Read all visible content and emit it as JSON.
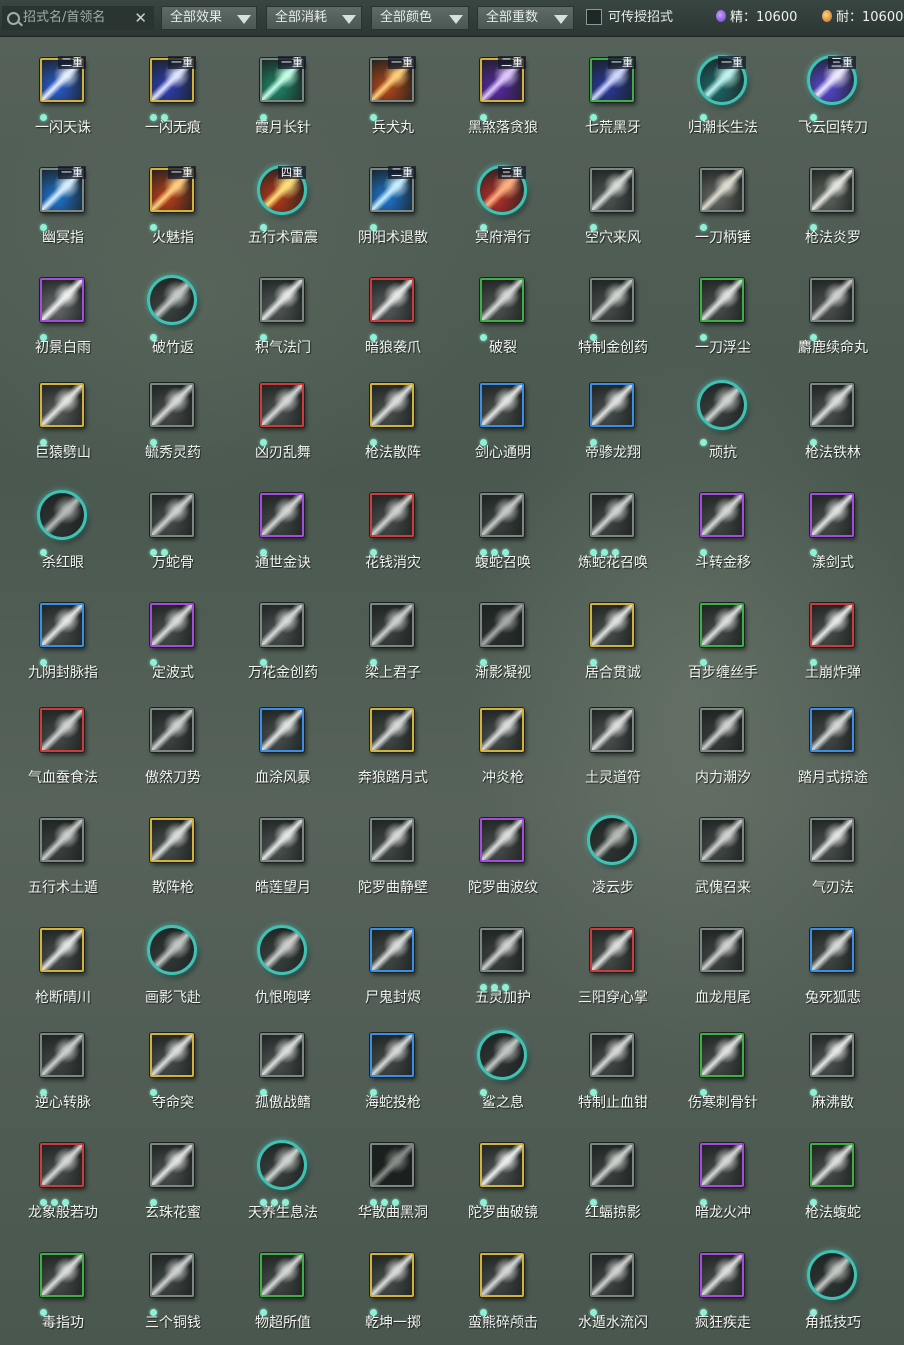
{
  "filters": {
    "search_placeholder": "招式名/首领名",
    "clear_glyph": "✕",
    "effect": "全部效果",
    "cost": "全部消耗",
    "color": "全部颜色",
    "tier": "全部重数",
    "passable_label": "可传授招式",
    "passable_checked": false
  },
  "resources": {
    "essence": "精：10600",
    "endurance": "耐：10600"
  },
  "border_colors": {
    "gold": "#d4b23a",
    "purple": "#a64ae0",
    "blue": "#3b8ee6",
    "red": "#cf3b3b",
    "green": "#3fae47",
    "gray": "#7c8682",
    "round": "#3fc2b4"
  },
  "skills": [
    {
      "name": "一闪天诛",
      "border": "gold",
      "tier": "二重",
      "dots": 1,
      "art": [
        "#2a5fd8",
        "#e6f0ff"
      ]
    },
    {
      "name": "一闪无痕",
      "border": "gold",
      "tier": "一重",
      "dots": 2,
      "art": [
        "#2f3fb8",
        "#dfe6ff"
      ]
    },
    {
      "name": "霞月长针",
      "border": "gray",
      "tier": "一重",
      "dots": 1,
      "art": [
        "#1f8a6a",
        "#c6ffe8"
      ]
    },
    {
      "name": "兵犬丸",
      "border": "gray",
      "tier": "一重",
      "dots": 1,
      "art": [
        "#b8491a",
        "#ffcf7a"
      ]
    },
    {
      "name": "黑煞落贪狼",
      "border": "gold",
      "tier": "二重",
      "dots": 1,
      "art": [
        "#5a2aa8",
        "#e0c8ff"
      ]
    },
    {
      "name": "七荒黑牙",
      "border": "green",
      "tier": "一重",
      "dots": 1,
      "art": [
        "#2a3aa0",
        "#d0d8ff"
      ]
    },
    {
      "name": "归潮长生法",
      "border": "round",
      "tier": "一重",
      "dots": 1,
      "art": [
        "#1d6a6a",
        "#bff5ee"
      ]
    },
    {
      "name": "飞云回转刀",
      "border": "round",
      "tier": "三重",
      "dots": 1,
      "art": [
        "#5a4ad8",
        "#eee8ff"
      ]
    },
    {
      "name": "幽冥指",
      "border": "gray",
      "tier": "一重",
      "dots": 1,
      "art": [
        "#1e78d8",
        "#d8f0ff"
      ]
    },
    {
      "name": "火魅指",
      "border": "gold",
      "tier": "一重",
      "dots": 1,
      "art": [
        "#c2401a",
        "#ffd080"
      ]
    },
    {
      "name": "五行术雷震",
      "border": "round",
      "tier": "四重",
      "dots": 1,
      "art": [
        "#b83a1a",
        "#ffe07a"
      ]
    },
    {
      "name": "阴阳术退散",
      "border": "gray",
      "tier": "二重",
      "dots": 1,
      "art": [
        "#1e7ad8",
        "#c8f0ff"
      ]
    },
    {
      "name": "冥府滑行",
      "border": "round",
      "tier": "三重",
      "dots": 1,
      "art": [
        "#b8302a",
        "#ffb080"
      ]
    },
    {
      "name": "空穴来风",
      "border": "gray",
      "tier": "",
      "dots": 1,
      "art": [
        "#505a58",
        "#d8dcd8"
      ]
    },
    {
      "name": "一刀柄锤",
      "border": "gray",
      "tier": "",
      "dots": 1,
      "art": [
        "#6a6c66",
        "#e0ded2"
      ]
    },
    {
      "name": "枪法炎罗",
      "border": "gray",
      "tier": "",
      "dots": 1,
      "art": [
        "#626860",
        "#e6e6e0"
      ]
    },
    {
      "name": "初景白雨",
      "border": "purple",
      "tier": "",
      "dots": 1,
      "art": [
        "#6a6e70",
        "#f0f0f0"
      ]
    },
    {
      "name": "破竹返",
      "border": "round",
      "tier": "",
      "dots": 1,
      "art": [
        "#3c4442",
        "#c8ccc8"
      ]
    },
    {
      "name": "积气法门",
      "border": "gray",
      "tier": "",
      "dots": 1,
      "art": [
        "#555c5a",
        "#e6e8e6"
      ]
    },
    {
      "name": "暗狼袭爪",
      "border": "red",
      "tier": "",
      "dots": 1,
      "art": [
        "#5a5e60",
        "#e8e8e8"
      ]
    },
    {
      "name": "破裂",
      "border": "green",
      "tier": "",
      "dots": 1,
      "art": [
        "#505654",
        "#d8dad8"
      ]
    },
    {
      "name": "特制金创药",
      "border": "gray",
      "tier": "",
      "dots": 1,
      "art": [
        "#4a504e",
        "#d0d4d0"
      ]
    },
    {
      "name": "一刀浮尘",
      "border": "green",
      "tier": "",
      "dots": 1,
      "art": [
        "#4c5250",
        "#e0e2e0"
      ]
    },
    {
      "name": "麝鹿续命丸",
      "border": "gray",
      "tier": "",
      "dots": 1,
      "art": [
        "#505452",
        "#d0d2d0"
      ]
    },
    {
      "name": "巨猿劈山",
      "border": "gold",
      "tier": "",
      "dots": 1,
      "art": [
        "#5a5e5c",
        "#e4e4e0"
      ]
    },
    {
      "name": "毓秀灵药",
      "border": "gray",
      "tier": "",
      "dots": 1,
      "art": [
        "#4a4e4c",
        "#d8dad8"
      ]
    },
    {
      "name": "凶刃乱舞",
      "border": "red",
      "tier": "",
      "dots": 1,
      "art": [
        "#4e5250",
        "#d6d8d6"
      ]
    },
    {
      "name": "枪法散阵",
      "border": "gold",
      "tier": "",
      "dots": 1,
      "art": [
        "#4c5250",
        "#dcdedc"
      ]
    },
    {
      "name": "剑心通明",
      "border": "blue",
      "tier": "",
      "dots": 1,
      "art": [
        "#4c5250",
        "#e2e4e2"
      ]
    },
    {
      "name": "帝骖龙翔",
      "border": "blue",
      "tier": "",
      "dots": 1,
      "art": [
        "#4a5050",
        "#e0e2e0"
      ]
    },
    {
      "name": "顽抗",
      "border": "round",
      "tier": "",
      "dots": 1,
      "art": [
        "#3a4240",
        "#d0d4d0"
      ]
    },
    {
      "name": "枪法铁林",
      "border": "gray",
      "tier": "",
      "dots": 1,
      "art": [
        "#4e5452",
        "#dcdedc"
      ]
    },
    {
      "name": "杀红眼",
      "border": "round",
      "tier": "",
      "dots": 1,
      "art": [
        "#2e3634",
        "#b8bcb8"
      ]
    },
    {
      "name": "万蛇骨",
      "border": "gray",
      "tier": "",
      "dots": 2,
      "art": [
        "#4a504e",
        "#cfd2cf"
      ]
    },
    {
      "name": "通世金诀",
      "border": "purple",
      "tier": "",
      "dots": 1,
      "art": [
        "#444a48",
        "#d4d6d4"
      ]
    },
    {
      "name": "花钱消灾",
      "border": "red",
      "tier": "",
      "dots": 1,
      "art": [
        "#4a4e4c",
        "#d0d2d0"
      ]
    },
    {
      "name": "蝮蛇召唤",
      "border": "gray",
      "tier": "",
      "dots": 3,
      "art": [
        "#3e4442",
        "#c8ccc8"
      ]
    },
    {
      "name": "炼蛇花召唤",
      "border": "gray",
      "tier": "",
      "dots": 3,
      "art": [
        "#424846",
        "#d2d4d2"
      ]
    },
    {
      "name": "斗转金移",
      "border": "purple",
      "tier": "",
      "dots": 1,
      "art": [
        "#464c4a",
        "#d6d8d6"
      ]
    },
    {
      "name": "漾剑式",
      "border": "purple",
      "tier": "",
      "dots": 1,
      "art": [
        "#4a504e",
        "#e0e2e0"
      ]
    },
    {
      "name": "九阴封脉指",
      "border": "blue",
      "tier": "",
      "dots": 1,
      "art": [
        "#4c5250",
        "#e4e6e4"
      ]
    },
    {
      "name": "定波式",
      "border": "purple",
      "tier": "",
      "dots": 1,
      "art": [
        "#4a504e",
        "#dadcda"
      ]
    },
    {
      "name": "万花金创药",
      "border": "gray",
      "tier": "",
      "dots": 1,
      "art": [
        "#4e5452",
        "#d8dad8"
      ]
    },
    {
      "name": "梁上君子",
      "border": "gray",
      "tier": "",
      "dots": 1,
      "art": [
        "#3e4442",
        "#cdd0cd"
      ]
    },
    {
      "name": "渐影凝视",
      "border": "gray",
      "tier": "",
      "dots": 1,
      "art": [
        "#2c3230",
        "#a8aca8"
      ]
    },
    {
      "name": "居合贯诚",
      "border": "gold",
      "tier": "",
      "dots": 1,
      "art": [
        "#4a504e",
        "#e0e2e0"
      ]
    },
    {
      "name": "百步缠丝手",
      "border": "green",
      "tier": "",
      "dots": 1,
      "art": [
        "#464c4a",
        "#dcdedc"
      ]
    },
    {
      "name": "土崩炸弹",
      "border": "red",
      "tier": "",
      "dots": 1,
      "art": [
        "#4a504e",
        "#e6e8e6"
      ]
    },
    {
      "name": "气血蚕食法",
      "border": "red",
      "tier": "",
      "dots": 0,
      "art": [
        "#464c4a",
        "#d2d4d2"
      ]
    },
    {
      "name": "傲然刀势",
      "border": "gray",
      "tier": "",
      "dots": 0,
      "art": [
        "#424846",
        "#d0d2d0"
      ]
    },
    {
      "name": "血涂风暴",
      "border": "blue",
      "tier": "",
      "dots": 0,
      "art": [
        "#4a5050",
        "#e2e4e2"
      ]
    },
    {
      "name": "奔狼踏月式",
      "border": "gold",
      "tier": "",
      "dots": 0,
      "art": [
        "#464c4a",
        "#d8dad8"
      ]
    },
    {
      "name": "冲炎枪",
      "border": "gold",
      "tier": "",
      "dots": 0,
      "art": [
        "#4a504e",
        "#dcdedc"
      ]
    },
    {
      "name": "土灵道符",
      "border": "gray",
      "tier": "",
      "dots": 0,
      "art": [
        "#505654",
        "#dcdedc"
      ]
    },
    {
      "name": "内力潮汐",
      "border": "gray",
      "tier": "",
      "dots": 0,
      "art": [
        "#3a403e",
        "#cfd2cf"
      ]
    },
    {
      "name": "踏月式掠途",
      "border": "blue",
      "tier": "",
      "dots": 0,
      "art": [
        "#464c4a",
        "#d6d8d6"
      ]
    },
    {
      "name": "五行术土遁",
      "border": "gray",
      "tier": "",
      "dots": 0,
      "art": [
        "#3e4442",
        "#cdd0cd"
      ]
    },
    {
      "name": "散阵枪",
      "border": "gold",
      "tier": "",
      "dots": 0,
      "art": [
        "#4a504e",
        "#dcdedc"
      ]
    },
    {
      "name": "皓莲望月",
      "border": "gray",
      "tier": "",
      "dots": 0,
      "art": [
        "#505654",
        "#e6e8e6"
      ]
    },
    {
      "name": "陀罗曲静壁",
      "border": "gray",
      "tier": "",
      "dots": 0,
      "art": [
        "#464c4a",
        "#d8dad8"
      ]
    },
    {
      "name": "陀罗曲波纹",
      "border": "purple",
      "tier": "",
      "dots": 0,
      "art": [
        "#4a504e",
        "#dcdedc"
      ]
    },
    {
      "name": "凌云步",
      "border": "round",
      "tier": "",
      "dots": 0,
      "art": [
        "#2e3634",
        "#b8bcb8"
      ]
    },
    {
      "name": "武傀召来",
      "border": "gray",
      "tier": "",
      "dots": 0,
      "art": [
        "#464c4a",
        "#d2d4d2"
      ]
    },
    {
      "name": "气刃法",
      "border": "gray",
      "tier": "",
      "dots": 0,
      "art": [
        "#4e5452",
        "#e2e4e2"
      ]
    },
    {
      "name": "枪断晴川",
      "border": "gold",
      "tier": "",
      "dots": 0,
      "art": [
        "#4a504e",
        "#e4e6e4"
      ]
    },
    {
      "name": "画影飞赴",
      "border": "round",
      "tier": "",
      "dots": 0,
      "art": [
        "#323a38",
        "#c4c8c4"
      ]
    },
    {
      "name": "仇恨咆哮",
      "border": "round",
      "tier": "",
      "dots": 0,
      "art": [
        "#3a4240",
        "#cdd0cd"
      ]
    },
    {
      "name": "尸鬼封烬",
      "border": "blue",
      "tier": "",
      "dots": 0,
      "art": [
        "#464c4a",
        "#dadcda"
      ]
    },
    {
      "name": "五灵加护",
      "border": "gray",
      "tier": "",
      "dots": 3,
      "art": [
        "#3e4442",
        "#d0d2d0"
      ]
    },
    {
      "name": "三阳穿心掌",
      "border": "red",
      "tier": "",
      "dots": 0,
      "art": [
        "#4a504e",
        "#dcdedc"
      ]
    },
    {
      "name": "血龙甩尾",
      "border": "gray",
      "tier": "",
      "dots": 0,
      "art": [
        "#424846",
        "#d0d2d0"
      ]
    },
    {
      "name": "兔死狐悲",
      "border": "blue",
      "tier": "",
      "dots": 0,
      "art": [
        "#464c4a",
        "#d8dad8"
      ]
    },
    {
      "name": "逆心转脉",
      "border": "gray",
      "tier": "",
      "dots": 1,
      "art": [
        "#424846",
        "#cdd0cd"
      ]
    },
    {
      "name": "夺命突",
      "border": "gold",
      "tier": "",
      "dots": 1,
      "art": [
        "#4a504e",
        "#dcdedc"
      ]
    },
    {
      "name": "孤傲战鳍",
      "border": "gray",
      "tier": "",
      "dots": 1,
      "art": [
        "#4e5452",
        "#dcdedc"
      ]
    },
    {
      "name": "海蛇投枪",
      "border": "blue",
      "tier": "",
      "dots": 1,
      "art": [
        "#464c4a",
        "#d6d8d6"
      ]
    },
    {
      "name": "鲨之息",
      "border": "round",
      "tier": "",
      "dots": 1,
      "art": [
        "#2e3634",
        "#c4c8c4"
      ]
    },
    {
      "name": "特制止血钳",
      "border": "gray",
      "tier": "",
      "dots": 1,
      "art": [
        "#464c4a",
        "#d6d8d6"
      ]
    },
    {
      "name": "伤寒刺骨针",
      "border": "green",
      "tier": "",
      "dots": 1,
      "art": [
        "#4a504e",
        "#e0e2e0"
      ]
    },
    {
      "name": "麻沸散",
      "border": "gray",
      "tier": "",
      "dots": 1,
      "art": [
        "#505654",
        "#e6e8e6"
      ]
    },
    {
      "name": "龙象般若功",
      "border": "red",
      "tier": "",
      "dots": 3,
      "art": [
        "#4a504e",
        "#d6d8d6"
      ]
    },
    {
      "name": "玄珠花蜜",
      "border": "gray",
      "tier": "",
      "dots": 1,
      "art": [
        "#4e5452",
        "#e2e4e2"
      ]
    },
    {
      "name": "天养生息法",
      "border": "round",
      "tier": "",
      "dots": 3,
      "art": [
        "#3a4240",
        "#d0d4d0"
      ]
    },
    {
      "name": "华散曲黑洞",
      "border": "gray",
      "tier": "",
      "dots": 3,
      "art": [
        "#1c2220",
        "#8a8e8a"
      ]
    },
    {
      "name": "陀罗曲破镜",
      "border": "gold",
      "tier": "",
      "dots": 1,
      "art": [
        "#505654",
        "#eceeec"
      ]
    },
    {
      "name": "红蝠掠影",
      "border": "gray",
      "tier": "",
      "dots": 1,
      "art": [
        "#3e4442",
        "#cdd0cd"
      ]
    },
    {
      "name": "暗龙火冲",
      "border": "purple",
      "tier": "",
      "dots": 1,
      "art": [
        "#464c4a",
        "#d6d8d6"
      ]
    },
    {
      "name": "枪法蝮蛇",
      "border": "green",
      "tier": "",
      "dots": 1,
      "art": [
        "#4a504e",
        "#dcdedc"
      ]
    },
    {
      "name": "毒指功",
      "border": "green",
      "tier": "",
      "dots": 1,
      "art": [
        "#4a504e",
        "#dcdedc"
      ]
    },
    {
      "name": "三个铜钱",
      "border": "gray",
      "tier": "",
      "dots": 1,
      "art": [
        "#424846",
        "#d0d2d0"
      ]
    },
    {
      "name": "物超所值",
      "border": "green",
      "tier": "",
      "dots": 1,
      "art": [
        "#464c4a",
        "#d6d8d6"
      ]
    },
    {
      "name": "乾坤一掷",
      "border": "gold",
      "tier": "",
      "dots": 1,
      "art": [
        "#4a504e",
        "#dadcda"
      ]
    },
    {
      "name": "蛮熊碎颅击",
      "border": "gold",
      "tier": "",
      "dots": 1,
      "art": [
        "#464c4a",
        "#d6d8d6"
      ]
    },
    {
      "name": "水遁水流闪",
      "border": "gray",
      "tier": "",
      "dots": 1,
      "art": [
        "#424846",
        "#d0d2d0"
      ]
    },
    {
      "name": "疯狂疾走",
      "border": "purple",
      "tier": "",
      "dots": 1,
      "art": [
        "#4a504e",
        "#dcdedc"
      ]
    },
    {
      "name": "角抵技巧",
      "border": "round",
      "tier": "",
      "dots": 1,
      "art": [
        "#2e3634",
        "#c4c8c4"
      ]
    }
  ]
}
